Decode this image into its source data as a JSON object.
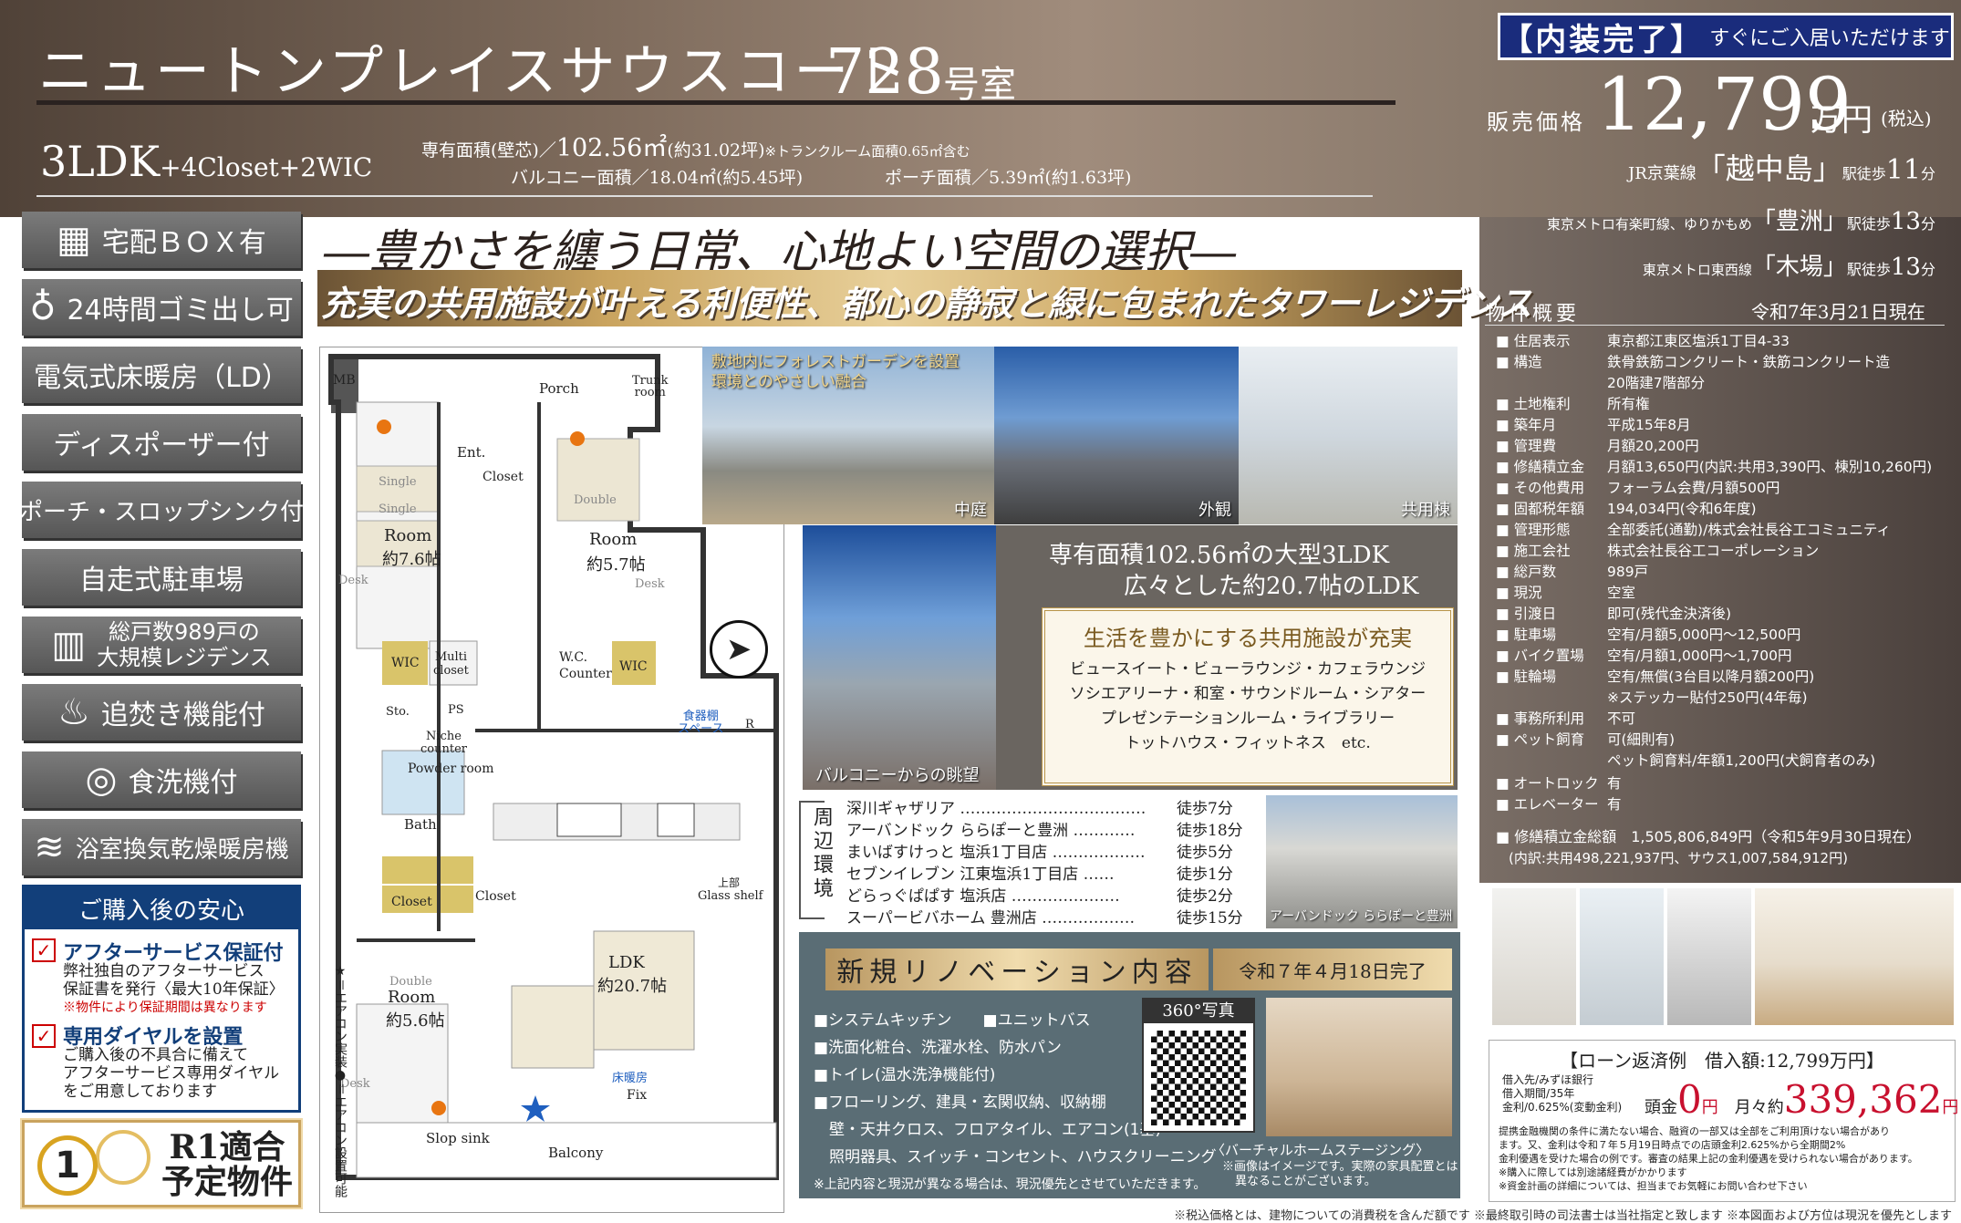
{
  "header": {
    "building_name": "ニュートンプレイスサウスコート",
    "room_number": "728",
    "room_suffix": "号室",
    "layout_type": "3LDK",
    "layout_extra": "+4Closet+2WIC",
    "private_area_label": "専有面積(壁芯)／",
    "private_area_value": "102.56㎡",
    "private_area_tsubo": "(約31.02坪)",
    "trunk_note": "※トランクルーム面積0.65㎡含む",
    "balcony_label": "バルコニー面積／",
    "balcony_value": "18.04㎡(約5.45坪)",
    "porch_label": "ポーチ面積／",
    "porch_value": "5.39㎡(約1.63坪)"
  },
  "banner": {
    "big": "【内装完了】",
    "small": "すぐにご入居いただけます"
  },
  "price": {
    "label": "販売価格",
    "value": "12,799",
    "unit": "万円",
    "tax": "(税込)"
  },
  "stations": [
    {
      "line": "JR京葉線",
      "name": "「越中島」",
      "walk": "駅徒歩",
      "minutes": "11",
      "unit": "分"
    },
    {
      "line": "東京メトロ有楽町線、ゆりかもめ",
      "name": "「豊洲」",
      "walk": "駅徒歩",
      "minutes": "13",
      "unit": "分"
    },
    {
      "line": "東京メトロ東西線",
      "name": "「木場」",
      "walk": "駅徒歩",
      "minutes": "13",
      "unit": "分"
    }
  ],
  "features": [
    {
      "icon": "▦",
      "icon_name": "delivery-box-icon",
      "label": "宅配ＢＯＸ有"
    },
    {
      "icon": "♁",
      "icon_name": "garbage-bag-icon",
      "label": "24時間ゴミ出し可"
    },
    {
      "icon": "",
      "icon_name": "",
      "label": "電気式床暖房（LD）"
    },
    {
      "icon": "",
      "icon_name": "",
      "label": "ディスポーザー付"
    },
    {
      "icon": "",
      "icon_name": "",
      "label": "ポーチ・スロップシンク付"
    },
    {
      "icon": "",
      "icon_name": "",
      "label": "自走式駐車場"
    },
    {
      "icon": "▥",
      "icon_name": "building-icon",
      "label": "総戸数989戸の\n大規模レジデンス"
    },
    {
      "icon": "♨",
      "icon_name": "reheat-bath-icon",
      "label": "追焚き機能付"
    },
    {
      "icon": "◎",
      "icon_name": "dishwasher-icon",
      "label": "食洗機付"
    },
    {
      "icon": "≋",
      "icon_name": "bath-dryer-icon",
      "label": "浴室換気乾燥暖房機"
    }
  ],
  "slogans": {
    "main": "―豊かさを纏う日常、心地よい空間の選択―",
    "sub": "充実の共用施設が叶える利便性、都心の静寂と緑に包まれたタワーレジデンス"
  },
  "anshin": {
    "title": "ご購入後の安心",
    "items": [
      {
        "head": "アフターサービス保証付",
        "body1": "弊社独自のアフターサービス",
        "body2": "保証書を発行〈最大10年保証〉",
        "note": "※物件により保証期間は異なります"
      },
      {
        "head": "専用ダイヤルを設置",
        "body1": "ご購入後の不具合に備えて",
        "body2": "アフターサービス専用ダイヤル",
        "body3": "をご用意しております"
      }
    ]
  },
  "r1": {
    "badge": "1",
    "line1": "R1適合",
    "line2": "予定物件"
  },
  "floorplan": {
    "mb": "MB",
    "porch": "Porch",
    "trunk": "Trunk\nroom",
    "single1": "Single",
    "single2": "Single",
    "room1": "Room",
    "room1_size": "約7.6帖",
    "desk1": "Desk",
    "ent": "Ent.",
    "closet1": "Closet",
    "double1": "Double",
    "room2": "Room",
    "room2_size": "約5.7帖",
    "desk2": "Desk",
    "wic1": "WIC",
    "multi": "Multi\ncloset",
    "wc": "W.C.",
    "counter": "Counter",
    "wic2": "WIC",
    "sto": "Sto.",
    "ps": "PS",
    "niche": "Niche\ncounter",
    "powder": "Powder room",
    "pantry": "食器棚\nスペース",
    "r": "R",
    "bath": "Bath",
    "closet2": "Closet",
    "closet3": "Closet",
    "glass": "Glass shelf",
    "upper": "上部",
    "ldk": "LDK",
    "ldk_size": "約20.7帖",
    "double2": "Double",
    "room3": "Room",
    "room3_size": "約5.6帖",
    "desk3": "Desk",
    "floor_heat": "床暖房",
    "fix": "Fix",
    "slop": "Slop sink",
    "balcony": "Balcony",
    "ac_legend1": "★＝エアコン実装",
    "ac_legend2": "●＝エアコン設置可能"
  },
  "photos": {
    "courtyard_caption": "中庭",
    "courtyard_overlay": "敷地内にフォレストガーデンを設置\n環境とのやさしい融合",
    "exterior_caption": "外観",
    "common_caption": "共用棟",
    "view_caption": "バルコニーからの眺望",
    "big_ldk1": "専有面積102.56㎡の大型3LDK",
    "big_ldk2": "広々とした約20.7帖のLDK",
    "facility_title": "生活を豊かにする共用施設が充実",
    "facility_lines": [
      "ビュースイート・ビューラウンジ・カフェラウンジ",
      "ソシエアリーナ・和室・サウンドルーム・シアター",
      "プレゼンテーションルーム・ライブラリー",
      "トットハウス・フィットネス　etc."
    ]
  },
  "surroundings": {
    "label": "周辺環境",
    "items": [
      {
        "name": "深川ギャザリア ………………………………",
        "walk": "徒歩7分"
      },
      {
        "name": "アーバンドック ららぽーと豊洲 …………",
        "walk": "徒歩18分"
      },
      {
        "name": "まいばすけっと 塩浜1丁目店 ………………",
        "walk": "徒歩5分"
      },
      {
        "name": "セブンイレブン 江東塩浜1丁目店 ……",
        "walk": "徒歩1分"
      },
      {
        "name": "どらっぐぱぱす 塩浜店 …………………",
        "walk": "徒歩2分"
      },
      {
        "name": "スーパービバホーム 豊洲店 ………………",
        "walk": "徒歩15分"
      }
    ],
    "lalaport_caption": "アーバンドック ららぽーと豊洲"
  },
  "renovation": {
    "title": "新規リノベーション内容",
    "date": "令和７年４月18日完了",
    "items": [
      "■システムキッチン　　■ユニットバス",
      "■洗面化粧台、洗濯水栓、防水パン",
      "■トイレ(温水洗浄機能付)",
      "■フローリング、建具・玄関収納、収納棚",
      "　壁・天井クロス、フロアタイル、エアコン(1基)",
      "　照明器具、スイッチ・コンセント、ハウスクリーニング"
    ],
    "note": "※上記内容と現況が異なる場合は、現況優先とさせていただきます。",
    "photo360": "360°写真",
    "staging_title": "〈バーチャルホームステージング〉",
    "staging_note1": "※画像はイメージです。実際の家具配置とは",
    "staging_note2": "異なることがございます。"
  },
  "overview": {
    "title": "物件概要",
    "date": "令和7年3月21日現在",
    "rows": [
      {
        "k": "■ 住居表示",
        "v": "東京都江東区塩浜1丁目4-33"
      },
      {
        "k": "■ 構造",
        "v": "鉄骨鉄筋コンクリート・鉄筋コンクリート造"
      },
      {
        "k": "",
        "v": "20階建7階部分"
      },
      {
        "k": "■ 土地権利",
        "v": "所有権"
      },
      {
        "k": "■ 築年月",
        "v": "平成15年8月"
      },
      {
        "k": "■ 管理費",
        "v": "月額20,200円"
      },
      {
        "k": "■ 修繕積立金",
        "v": "月額13,650円(内訳:共用3,390円、棟別10,260円)"
      },
      {
        "k": "■ その他費用",
        "v": "フォーラム会費/月額500円"
      },
      {
        "k": "■ 固都税年額",
        "v": "194,034円(令和6年度)"
      },
      {
        "k": "■ 管理形態",
        "v": "全部委託(通勤)/株式会社長谷工コミュニティ"
      },
      {
        "k": "■ 施工会社",
        "v": "株式会社長谷工コーポレーション"
      },
      {
        "k": "■ 総戸数",
        "v": "989戸"
      },
      {
        "k": "■ 現況",
        "v": "空室"
      },
      {
        "k": "■ 引渡日",
        "v": "即可(残代金決済後)"
      },
      {
        "k": "■ 駐車場",
        "v": "空有/月額5,000円〜12,500円"
      },
      {
        "k": "■ バイク置場",
        "v": "空有/月額1,000円〜1,700円"
      },
      {
        "k": "■ 駐輪場",
        "v": "空有/無償(3台目以降月額200円)"
      },
      {
        "k": "",
        "v": "※ステッカー貼付250円(4年毎)"
      },
      {
        "k": "■ 事務所利用",
        "v": "不可"
      },
      {
        "k": "■ ペット飼育",
        "v": "可(細則有)"
      },
      {
        "k": "",
        "v": "ペット飼育料/年額1,200円(犬飼育者のみ)"
      },
      {
        "k": "■ オートロック",
        "v": "有"
      },
      {
        "k": "■ エレベーター",
        "v": "有"
      }
    ],
    "reserve_total": "■ 修繕積立金総額　1,505,806,849円（令和5年9月30日現在）",
    "reserve_breakdown": "(内訳:共用498,221,937円、サウス1,007,584,912円)"
  },
  "loan": {
    "title": "【ローン返済例　借入額:12,799万円】",
    "lender": "借入先/みずほ銀行",
    "term": "借入期間/35年",
    "rate": "金利/0.625%(変動金利)",
    "down_label": "頭金",
    "down_value": "0",
    "down_unit": "円",
    "monthly_label": "月々約",
    "monthly_value": "339,362",
    "monthly_unit": "円",
    "notes": [
      "提携金融機関の条件に満たない場合、融資の一部又は全部をご利用頂けない場合があり",
      "ます。又、金利は令和７年５月19日時点での店頭金利2.625%から全期間2%",
      "金利優遇を受けた場合の例です。審査の結果上記の金利優遇を受けられない場合があります。",
      "※購入に際しては別途諸経費がかかります",
      "※資金計画の詳細については、担当までお気軽にお問い合わせ下さい"
    ]
  },
  "footer": "※税込価格とは、建物についての消費税を含んだ額です ※最終取引時の司法書士は当社指定と致します ※本図面および方位は現況を優先とします",
  "colors": {
    "navy": "#1a2c7c",
    "gold": "#c9a35e",
    "price_red": "#c8102e",
    "feature_grey": "#676767",
    "ac_orange": "#e87511"
  }
}
